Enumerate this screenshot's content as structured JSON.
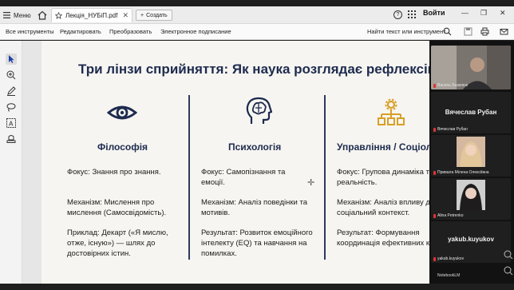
{
  "tabbar": {
    "menu_label": "Меню",
    "tab_title": "Лекція_НУБіП.pdf",
    "create_label": "Создать",
    "signin_label": "Войти"
  },
  "toolbar": {
    "items": [
      "Все инструменты",
      "Редактировать",
      "Преобразовать",
      "Электронное подписание"
    ],
    "search_label": "Найти текст или инструмент"
  },
  "slide": {
    "title": "Три лінзи сприйняття: Як наука розглядає рефлексію",
    "columns": [
      {
        "heading": "Філософія",
        "icon": "eye-icon",
        "blocks": [
          "Фокус: Знання про знання.",
          "Механізм: Мислення про мислення (Самосвідомість).",
          "Приклад: Декарт («Я мислю, отже, існую») — шлях до достовірних істин."
        ]
      },
      {
        "heading": "Психологія",
        "icon": "brain-head-icon",
        "blocks": [
          "Фокус: Самопізнання та емоції.",
          "Механізм: Аналіз поведінки та мотивів.",
          "Результат: Розвиток емоційного інтелекту (EQ) та навчання на помилках."
        ]
      },
      {
        "heading": "Управління / Соціологія",
        "icon": "org-chart-icon",
        "blocks": [
          "Фокус: Групова динаміка та реальність.",
          "Механізм: Аналіз впливу дій на соціальний контекст.",
          "Результат: Формування координація ефективних команд."
        ]
      }
    ]
  },
  "participants": {
    "video1_name": "Василь Базелюк",
    "bigname1": "Вячеслав Рубан",
    "name2": "Вячеслав Рубан",
    "name3": "Привала Мілена Олексіївна",
    "name4": "Alina Petrenko",
    "bigname5": "yakub.kuyukov",
    "name5": "yakub.kuyukov",
    "brand": "NotebookLM"
  },
  "colors": {
    "title_navy": "#1d2b4f",
    "icon_gold": "#d8a028",
    "mic_red": "#e03434"
  }
}
